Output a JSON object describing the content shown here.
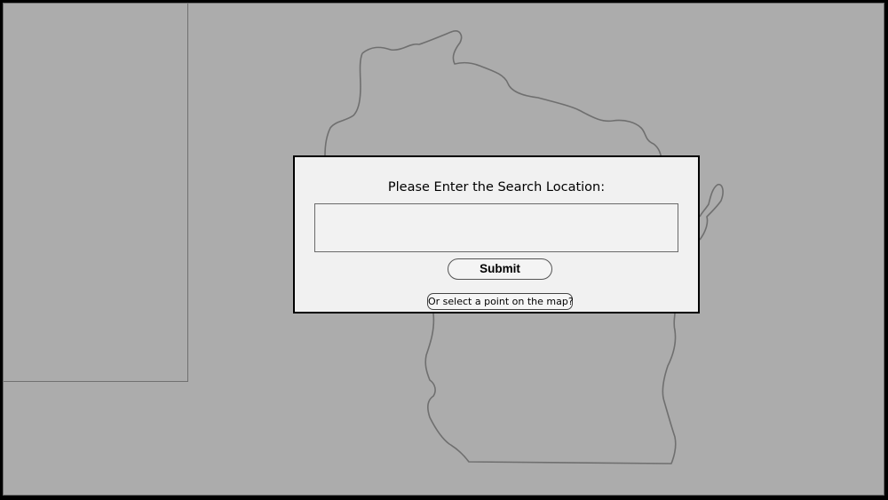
{
  "search_dialog": {
    "title": "Please Enter the Search Location:",
    "input_value": "",
    "input_placeholder": "",
    "submit_label": "Submit",
    "map_select_label": "Or select a point on the map?"
  },
  "map": {
    "region": "wisconsin-outline",
    "colors": {
      "background": "#acacac",
      "outline": "#6f6f6f",
      "dialog_bg": "#f1f1f1"
    }
  }
}
